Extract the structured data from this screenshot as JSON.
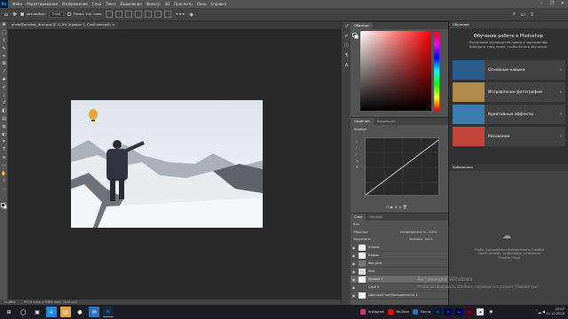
{
  "app": {
    "logo": "Ps"
  },
  "menu": [
    "Файл",
    "Редактирование",
    "Изображение",
    "Слои",
    "Текст",
    "Выделение",
    "Фильтр",
    "3D",
    "Просмотр",
    "Окно",
    "Справка"
  ],
  "window_controls": [
    "–",
    "❐",
    "✕"
  ],
  "options": {
    "autoselect_label": "Автовыбор:",
    "layer_dropdown": "Слой",
    "show_controls": "Показ. упр. элем."
  },
  "document": {
    "tab_title": "photo@pixabay_final.psd @ 11,8% (Кривые 1, Слой-маска/8)",
    "zoom_status": "11,88%",
    "size_status": "9724 пикс x 6484 пикс (300 ppi)"
  },
  "color_panel": {
    "tab": "Образцы"
  },
  "properties_panel": {
    "tabs": [
      "Свойства",
      "Коррекция"
    ],
    "subtitle": "Кривые"
  },
  "layers_panel": {
    "tabs": [
      "Слои",
      "Каналы"
    ],
    "filter_label": "Вид",
    "blend_mode": "Обычные",
    "opacity_label": "Непрозрачность:",
    "opacity_value": "100%",
    "lock_label": "Закрепить:",
    "fill_label": "Заливка:",
    "fill_value": "100%",
    "layers": [
      {
        "name": "Шляпа",
        "thumb": "#f0f0f0"
      },
      {
        "name": "Шарик",
        "thumb": "#f0f0f0"
      },
      {
        "name": "Фигурка",
        "thumb": "#777"
      },
      {
        "name": "Фон",
        "thumb": "#d8d8d8"
      },
      {
        "name": "Кривые 1",
        "thumb": "#ffffff"
      },
      {
        "name": "Слой 4",
        "thumb": "#555"
      },
      {
        "name": "Цветовой тон/Насыщенность 1",
        "thumb": "#ffffff"
      }
    ]
  },
  "libraries_panel": {
    "tab": "Библиотеки",
    "message": "Чтобы пользоваться библиотеками Creative Cloud Libraries, необходимо установить Creative Cloud."
  },
  "learn_panel": {
    "tab": "Обучение",
    "title": "Обучение работе в Photoshop",
    "desc_line1": "Пошаговые руководства прямо в приложении.",
    "desc_line2": "Выберите тему ниже, чтобы начать обучение.",
    "items": [
      {
        "label": "Основные навыки",
        "color": "#2b5d8c"
      },
      {
        "label": "Исправление фотографий",
        "color": "#b08a4a"
      },
      {
        "label": "Креативные эффекты",
        "color": "#3b7bb0"
      },
      {
        "label": "Рисование",
        "color": "#c4443c"
      }
    ]
  },
  "watermark": {
    "line1": "Активация Windows",
    "line2": "Чтобы активировать Windows, перейдите в раздел \"Параметры\"."
  },
  "taskbar": {
    "items": [
      {
        "icon": "⊞",
        "color": "#1c1c22"
      },
      {
        "icon": "◯",
        "color": "#1c1c22"
      },
      {
        "icon": "▣",
        "color": "#1c1c22"
      },
      {
        "icon": "e",
        "color": "#1e88e5"
      },
      {
        "icon": "▥",
        "color": "#e8a33a"
      },
      {
        "icon": "●",
        "color": "#1c1c22"
      },
      {
        "icon": "✉",
        "color": "#2b73c9"
      },
      {
        "icon": "Ps",
        "color": "#0f2a44"
      }
    ],
    "pinned": [
      "Instagram",
      "YouTube",
      "Почта"
    ],
    "time": "22:07",
    "date": "11.12.2020"
  }
}
